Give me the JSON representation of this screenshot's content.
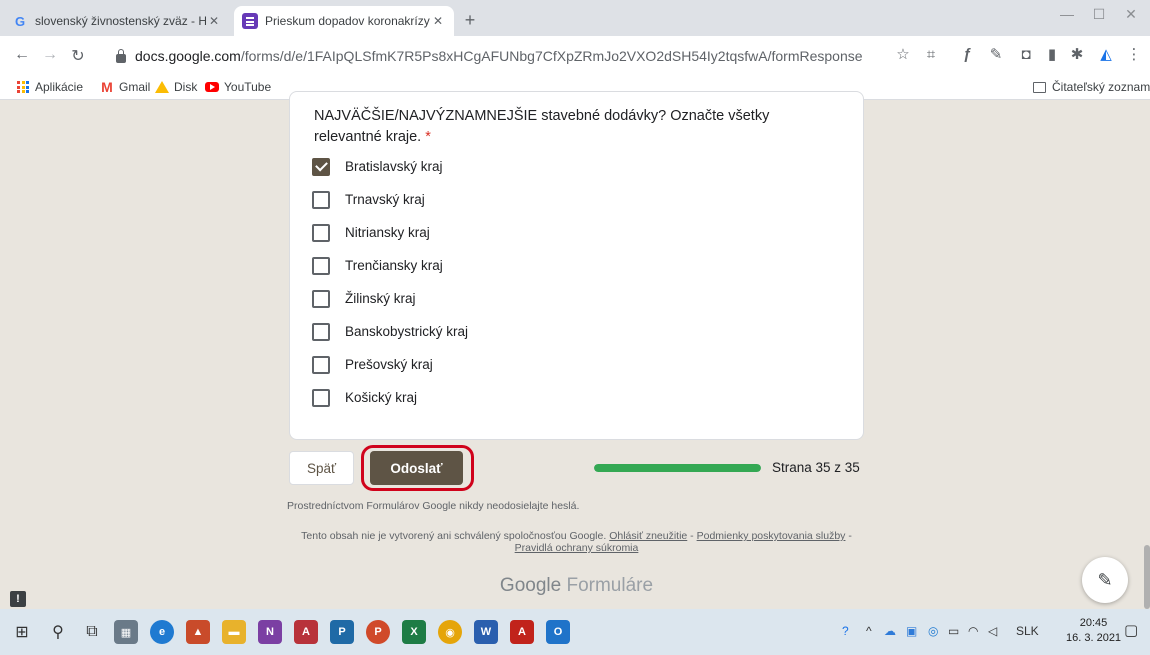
{
  "browser": {
    "tabs": [
      {
        "title": "slovenský živnostenský zväz - Hľa",
        "active": false
      },
      {
        "title": "Prieskum dopadov koronakrízy n",
        "active": true
      }
    ],
    "new_tab": "+",
    "url_host": "docs.google.com",
    "url_path": "/forms/d/e/1FAIpQLSfmK7R5Ps8xHCgAFUNbg7CfXpZRmJo2VXO2dSH54Iy2tqsfwA/formResponse",
    "bookmarks": [
      "Aplikácie",
      "Gmail",
      "Disk",
      "YouTube"
    ],
    "reading_list": "Čitateľský zoznam"
  },
  "form": {
    "question_text": "NAJVÄČŠIE/NAJVÝZNAMNEJŠIE stavebné dodávky? Označte všetky relevantné kraje.",
    "required_mark": "*",
    "options": [
      {
        "label": "Bratislavský kraj",
        "checked": true
      },
      {
        "label": "Trnavský kraj",
        "checked": false
      },
      {
        "label": "Nitriansky kraj",
        "checked": false
      },
      {
        "label": "Trenčiansky kraj",
        "checked": false
      },
      {
        "label": "Žilinský kraj",
        "checked": false
      },
      {
        "label": "Banskobystrický kraj",
        "checked": false
      },
      {
        "label": "Prešovský kraj",
        "checked": false
      },
      {
        "label": "Košický kraj",
        "checked": false
      }
    ],
    "back_button": "Späť",
    "submit_button": "Odoslať",
    "progress_fraction": 1.0,
    "progress_text": "Strana 35 z 35",
    "password_note": "Prostredníctvom Formulárov Google nikdy neodosielajte heslá.",
    "legal_text": "Tento obsah nie je vytvorený ani schválený spoločnosťou Google.",
    "legal_links": [
      "Ohlásiť zneužitie",
      "Podmienky poskytovania služby",
      "Pravidlá ochrany súkromia"
    ],
    "logo_google": "Google",
    "logo_product": "Formuláre"
  },
  "taskbar": {
    "language": "SLK",
    "time": "20:45",
    "date": "16. 3. 2021"
  },
  "colors": {
    "theme": "#5e5445",
    "background": "#e9e5de",
    "progress": "#34a853",
    "highlight_ring": "#d0021b"
  }
}
